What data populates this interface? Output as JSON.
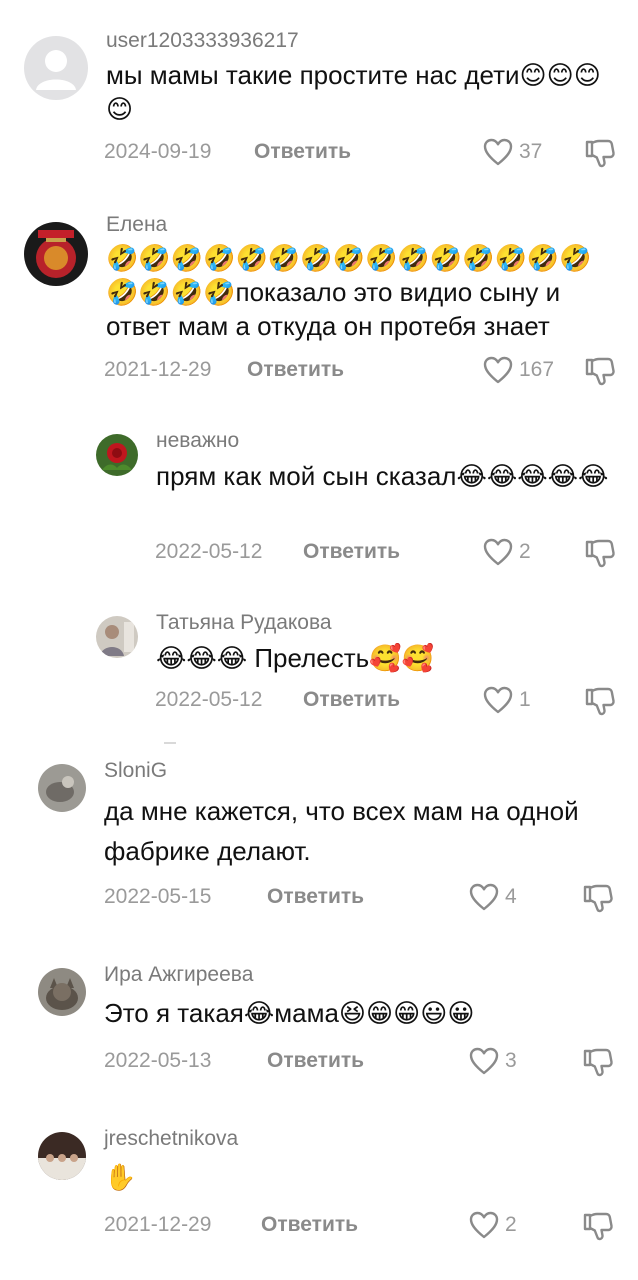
{
  "comments": [
    {
      "username": "user1203333936217",
      "text": "мы мамы такие простите нас дети😊😊😊😊",
      "date": "2024-09-19",
      "reply_label": "Ответить",
      "likes": "37"
    },
    {
      "username": "Елена",
      "text": "🤣🤣🤣🤣🤣🤣🤣🤣🤣🤣🤣🤣🤣🤣🤣🤣🤣🤣🤣показало это видио сыну и ответ мам а откуда он протебя знает",
      "date": "2021-12-29",
      "reply_label": "Ответить",
      "likes": "167"
    },
    {
      "username": "неважно",
      "text": "прям как мой сын сказал😂😂😂😂😂",
      "date": "2022-05-12",
      "reply_label": "Ответить",
      "likes": "2"
    },
    {
      "username": "Татьяна Рудакова",
      "text": "😂😂😂 Прелесть🥰🥰",
      "date": "2022-05-12",
      "reply_label": "Ответить",
      "likes": "1"
    },
    {
      "username": "SloniG",
      "text": "да мне кажется, что всех мам на одной фабрике делают.",
      "date": "2022-05-15",
      "reply_label": "Ответить",
      "likes": "4"
    },
    {
      "username": "Ира Ажгиреева",
      "text": "Это я такая😂мама😆😁😁😃😀",
      "date": "2022-05-13",
      "reply_label": "Ответить",
      "likes": "3"
    },
    {
      "username": "jreschetnikova",
      "text": "✋",
      "date": "2021-12-29",
      "reply_label": "Ответить",
      "likes": "2"
    }
  ],
  "colors": {
    "username": "#7a7a7a",
    "text": "#111111",
    "meta": "#9a9a9a",
    "icon_stroke": "#8a8a8a"
  },
  "icons": {
    "like": "heart-outline-icon",
    "dislike": "thumbs-down-outline-icon",
    "default_avatar": "person-placeholder-icon"
  }
}
